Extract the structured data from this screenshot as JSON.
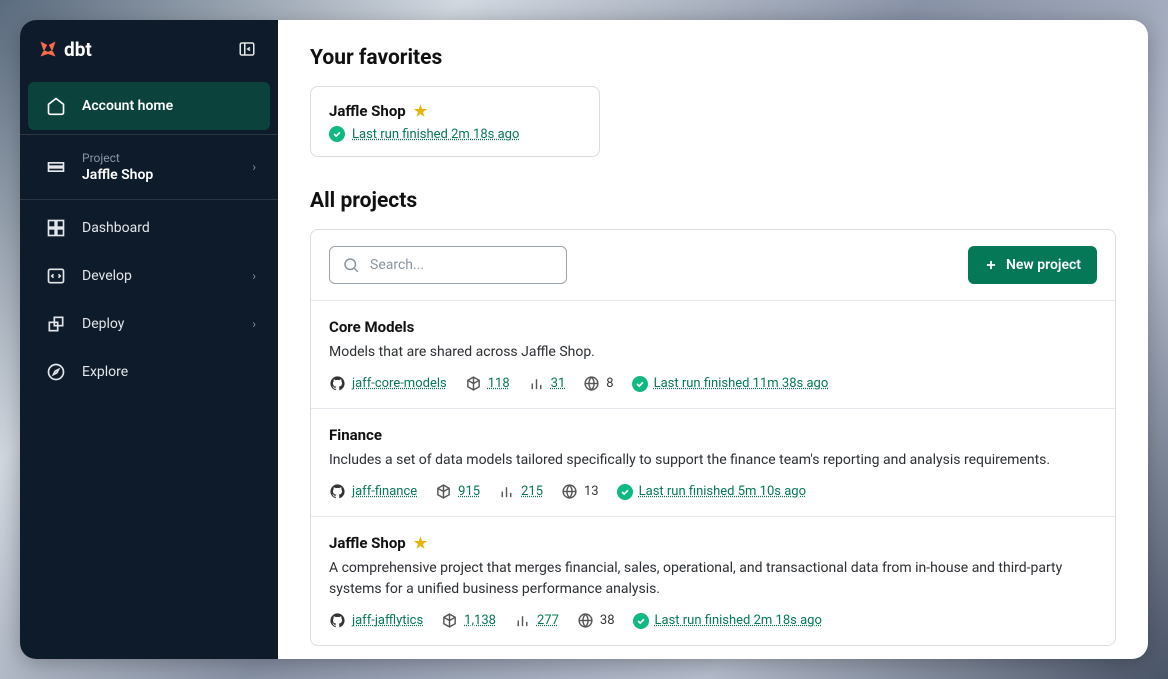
{
  "brand": "dbt",
  "sidebar": {
    "accountHome": "Account home",
    "projectLabel": "Project",
    "projectName": "Jaffle Shop",
    "dashboard": "Dashboard",
    "develop": "Develop",
    "deploy": "Deploy",
    "explore": "Explore"
  },
  "favorites": {
    "title": "Your favorites",
    "items": [
      {
        "name": "Jaffle Shop",
        "status": "Last run finished 2m 18s ago"
      }
    ]
  },
  "allProjects": {
    "title": "All projects",
    "searchPlaceholder": "Search...",
    "newBtn": "New project",
    "items": [
      {
        "name": "Core Models",
        "desc": "Models that are shared across Jaffle Shop.",
        "repo": "jaff-core-models",
        "models": "118",
        "metrics": "31",
        "envs": "8",
        "status": "Last run finished 11m 38s ago",
        "favorite": false
      },
      {
        "name": "Finance",
        "desc": "Includes a set of data models tailored specifically to support the finance team's reporting and analysis requirements.",
        "repo": "jaff-finance",
        "models": "915",
        "metrics": "215",
        "envs": "13",
        "status": "Last run finished 5m 10s ago",
        "favorite": false
      },
      {
        "name": "Jaffle Shop",
        "desc": "A comprehensive project that merges financial, sales, operational, and transactional data from in-house and third-party systems for a unified business performance analysis.",
        "repo": "jaff-jafflytics",
        "models": "1,138",
        "metrics": "277",
        "envs": "38",
        "status": "Last run finished 2m 18s ago",
        "favorite": true
      }
    ]
  }
}
